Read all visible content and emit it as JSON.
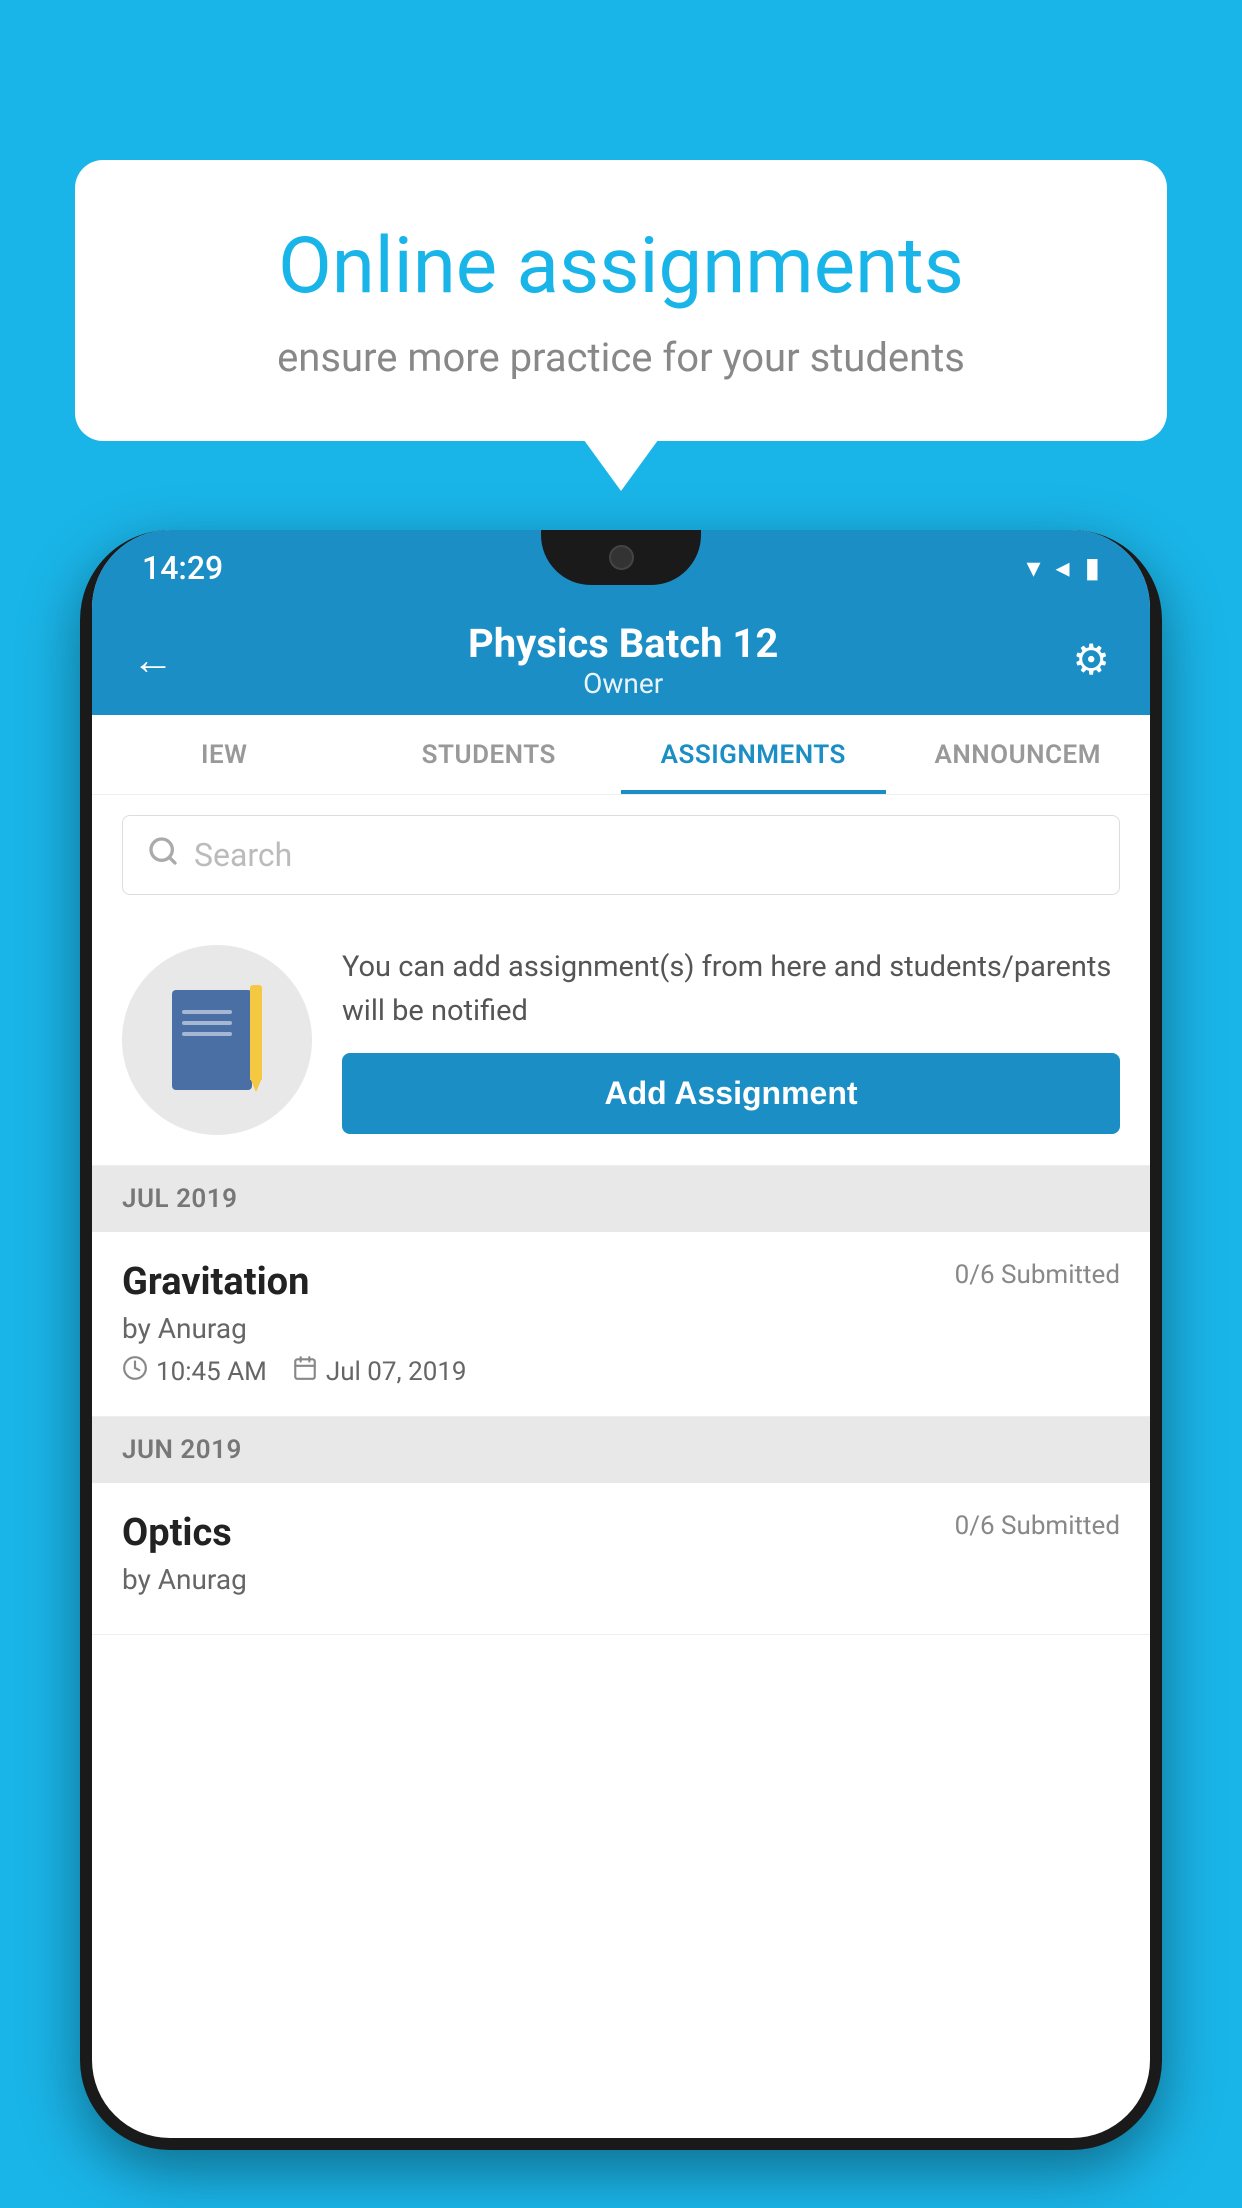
{
  "background_color": "#1ab5e8",
  "speech_bubble": {
    "title": "Online assignments",
    "subtitle": "ensure more practice for your students"
  },
  "phone": {
    "status_bar": {
      "time": "14:29",
      "icons": [
        "wifi",
        "signal",
        "battery"
      ]
    },
    "header": {
      "title": "Physics Batch 12",
      "subtitle": "Owner",
      "back_label": "←",
      "settings_label": "⚙"
    },
    "tabs": [
      {
        "label": "IEW",
        "active": false
      },
      {
        "label": "STUDENTS",
        "active": false
      },
      {
        "label": "ASSIGNMENTS",
        "active": true
      },
      {
        "label": "ANNOUNCEM",
        "active": false
      }
    ],
    "search": {
      "placeholder": "Search"
    },
    "promo": {
      "text": "You can add assignment(s) from here and students/parents will be notified",
      "button_label": "Add Assignment"
    },
    "sections": [
      {
        "month_label": "JUL 2019",
        "assignments": [
          {
            "title": "Gravitation",
            "submitted": "0/6 Submitted",
            "by": "by Anurag",
            "time": "10:45 AM",
            "date": "Jul 07, 2019"
          }
        ]
      },
      {
        "month_label": "JUN 2019",
        "assignments": [
          {
            "title": "Optics",
            "submitted": "0/6 Submitted",
            "by": "by Anurag",
            "time": "",
            "date": ""
          }
        ]
      }
    ]
  }
}
